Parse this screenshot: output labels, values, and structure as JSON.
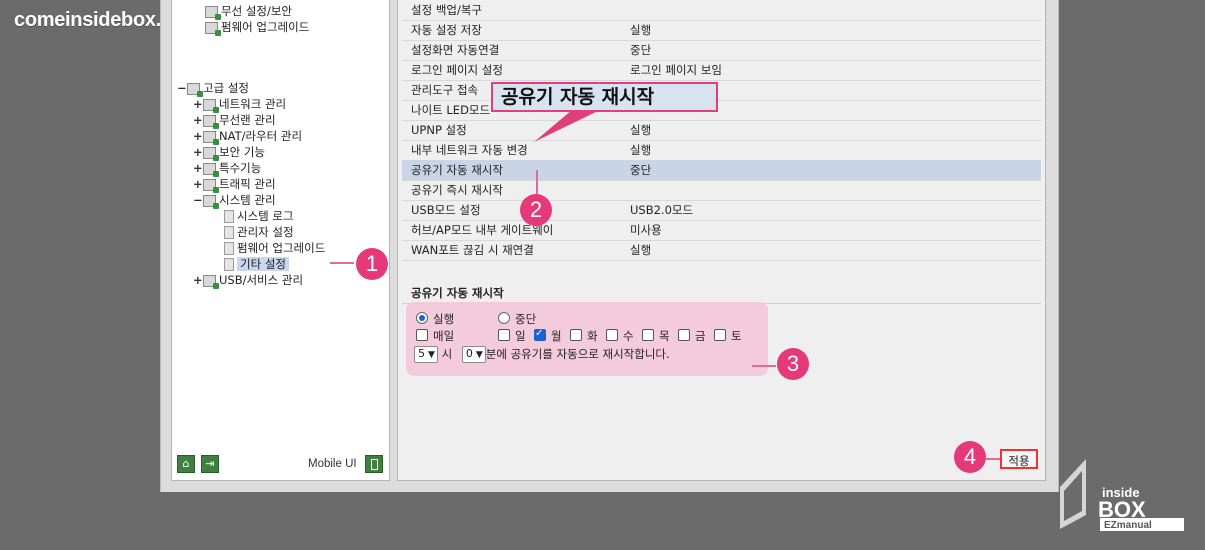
{
  "watermark": {
    "site": "comeinsidebox.com",
    "logo_top": "inside",
    "logo_mid": "BOX",
    "logo_bottom": "EZmanual"
  },
  "tree": {
    "items": [
      {
        "label": "무선 설정/보안",
        "icon": "wireless-icon"
      },
      {
        "label": "펌웨어 업그레이드",
        "icon": "firmware-icon"
      },
      {
        "label": "고급 설정",
        "expand": "−",
        "icon": "folder-icon"
      },
      {
        "label": "네트워크 관리",
        "expand": "+",
        "icon": "network-icon"
      },
      {
        "label": "무선랜 관리",
        "expand": "+",
        "icon": "wireless-icon"
      },
      {
        "label": "NAT/라우터 관리",
        "expand": "+",
        "icon": "router-icon"
      },
      {
        "label": "보안 기능",
        "expand": "+",
        "icon": "lock-icon"
      },
      {
        "label": "특수기능",
        "expand": "+",
        "icon": "special-icon"
      },
      {
        "label": "트래픽 관리",
        "expand": "+",
        "icon": "traffic-icon"
      },
      {
        "label": "시스템 관리",
        "expand": "−",
        "icon": "system-icon"
      },
      {
        "label": "시스템 로그",
        "icon": "page-icon"
      },
      {
        "label": "관리자 설정",
        "icon": "page-icon"
      },
      {
        "label": "펌웨어 업그레이드",
        "icon": "page-icon"
      },
      {
        "label": "기타 설정",
        "icon": "page-icon",
        "selected": true
      },
      {
        "label": "USB/서비스 관리",
        "expand": "+",
        "icon": "usb-icon"
      }
    ],
    "mobile_ui": "Mobile UI"
  },
  "settings": {
    "rows": [
      {
        "key": "설정 백업/복구",
        "value": ""
      },
      {
        "key": "자동 설정 저장",
        "value": "실행"
      },
      {
        "key": "설정화면 자동연결",
        "value": "중단"
      },
      {
        "key": "로그인 페이지 설정",
        "value": "로그인 페이지 보임"
      },
      {
        "key": "관리도구 접속",
        "value": ""
      },
      {
        "key": "나이트 LED모드",
        "value": ""
      },
      {
        "key": "UPNP 설정",
        "value": "실행"
      },
      {
        "key": "내부 네트워크 자동 변경",
        "value": "실행"
      },
      {
        "key": "공유기 자동 재시작",
        "value": "중단",
        "highlight": true
      },
      {
        "key": "공유기 즉시 재시작",
        "value": ""
      },
      {
        "key": "USB모드 설정",
        "value": "USB2.0모드"
      },
      {
        "key": "허브/AP모드 내부 게이트웨이",
        "value": "미사용"
      },
      {
        "key": "WAN포트 끊김 시 재연결",
        "value": "실행"
      }
    ]
  },
  "restart_section": {
    "title": "공유기 자동 재시작",
    "radio_run": "실행",
    "radio_stop": "중단",
    "daily": "매일",
    "days": [
      "일",
      "월",
      "화",
      "수",
      "목",
      "금",
      "토"
    ],
    "days_checked": [
      false,
      true,
      false,
      false,
      false,
      false,
      false
    ],
    "hour_value": "5",
    "hour_unit": "시",
    "minute_value": "0",
    "minute_suffix": "분에 공유기를 자동으로 재시작합니다."
  },
  "apply_label": "적용",
  "callout": {
    "text": "공유기 자동 재시작"
  },
  "badges": [
    "1",
    "2",
    "3",
    "4"
  ],
  "colors": {
    "badge": "#e6397a",
    "highlight_row": "#c9d5e6",
    "annotation_box": "#f4c7d7"
  }
}
